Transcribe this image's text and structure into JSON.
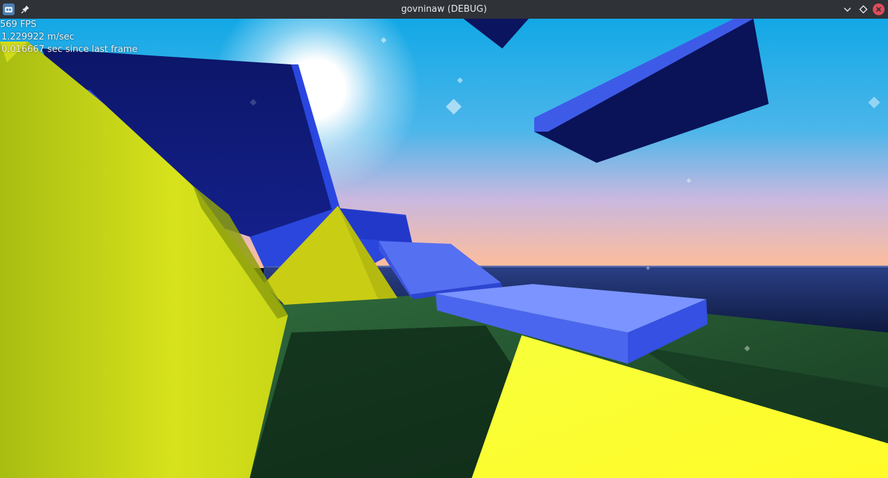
{
  "window": {
    "title": "govninaw (DEBUG)",
    "app_icon": "godot-icon",
    "pin_icon": "pin-icon",
    "controls": [
      "chevron-down-icon",
      "diamond-icon",
      "close-icon"
    ]
  },
  "hud": {
    "fps": "569 FPS",
    "speed": "1.229922 m/sec",
    "frame_time": "0.016667 sec since last frame"
  },
  "colors": {
    "titlebar": "#2f3237",
    "sky_top": "#1aa6e4",
    "sky_horizon": "#ffb9a0",
    "ocean": "#0e1a45",
    "ground": "#1f4a2a",
    "yellow": "#e6ee1e",
    "block_dark": "#0b145e",
    "block_light": "#6b86ff",
    "close": "#e04b5a"
  }
}
